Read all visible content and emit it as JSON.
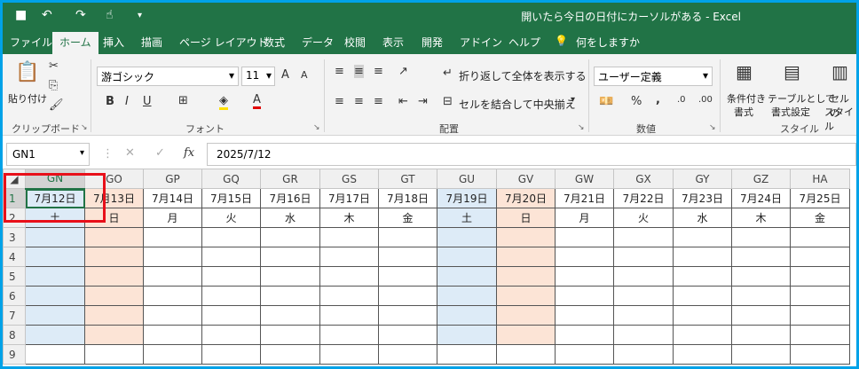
{
  "titlebar": {
    "title": "開いたら今日の日付にカーソルがある  -  Excel"
  },
  "menu": [
    "ファイル",
    "ホーム",
    "挿入",
    "描画",
    "ページ レイアウト",
    "数式",
    "データ",
    "校閲",
    "表示",
    "開発",
    "アドイン",
    "ヘルプ",
    "何をしますか"
  ],
  "ribbon": {
    "paste": "貼り付け",
    "clipboard": "クリップボード",
    "font_name": "游ゴシック",
    "font_size": "11",
    "font_group": "フォント",
    "wrap_text": "折り返して全体を表示する",
    "merge_center": "セルを結合して中央揃え",
    "alignment_group": "配置",
    "number_format": "ユーザー定義",
    "number_group": "数値",
    "cond_format": "条件付き",
    "cond_format2": "書式",
    "table_format": "テーブルとして",
    "table_format2": "書式設定",
    "cell_style": "セルの",
    "cell_style2": "スタイル",
    "styles_group": "スタイル",
    "bold": "B",
    "italic": "I",
    "underline": "U",
    "font_color": "A",
    "percent": "%",
    "comma": ","
  },
  "formula": {
    "namebox": "GN1",
    "fx": "fx",
    "value": "2025/7/12"
  },
  "columns": [
    "GN",
    "GO",
    "GP",
    "GQ",
    "GR",
    "GS",
    "GT",
    "GU",
    "GV",
    "GW",
    "GX",
    "GY",
    "GZ",
    "HA"
  ],
  "dates": [
    "7月12日",
    "7月13日",
    "7月14日",
    "7月15日",
    "7月16日",
    "7月17日",
    "7月18日",
    "7月19日",
    "7月20日",
    "7月21日",
    "7月22日",
    "7月23日",
    "7月24日",
    "7月25日"
  ],
  "weekdays": [
    "土",
    "日",
    "月",
    "火",
    "水",
    "木",
    "金",
    "土",
    "日",
    "月",
    "火",
    "水",
    "木",
    "金"
  ],
  "rows": [
    "1",
    "2",
    "3",
    "4",
    "5",
    "6",
    "7",
    "8",
    "9"
  ]
}
